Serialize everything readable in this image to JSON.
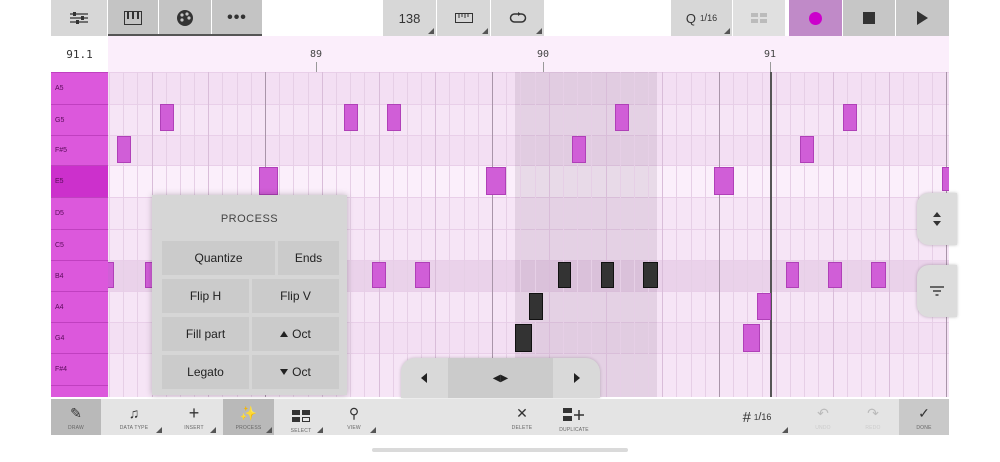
{
  "toolbar": {
    "tempo": "138",
    "quantize_label": "Q",
    "quantize_num": "1",
    "quantize_den": "16",
    "record_color": "#cc00cc"
  },
  "ruler": {
    "position": "91.1",
    "bars": [
      "89",
      "90",
      "91"
    ]
  },
  "keys": [
    "A5",
    "G5",
    "F#5",
    "E5",
    "D5",
    "C5",
    "B4",
    "A4",
    "G4",
    "F#4"
  ],
  "process": {
    "title": "PROCESS",
    "quantize": "Quantize",
    "ends": "Ends",
    "flip_h": "Flip H",
    "flip_v": "Flip V",
    "fill_part": "Fill part",
    "oct_up": "Oct",
    "legato": "Legato",
    "oct_down": "Oct"
  },
  "bottom": {
    "draw": "DRAW",
    "data_type": "DATA TYPE",
    "insert": "INSERT",
    "process": "PROCESS",
    "select": "SELECT",
    "view": "VIEW",
    "delete": "DELETE",
    "duplicate": "DUPLICATE",
    "grid_num": "1",
    "grid_den": "16",
    "undo": "UNDO",
    "redo": "REDO",
    "done": "DONE"
  },
  "colors": {
    "accent": "#dc58dc",
    "note": "#d05ed7",
    "selected_note": "#333333"
  }
}
